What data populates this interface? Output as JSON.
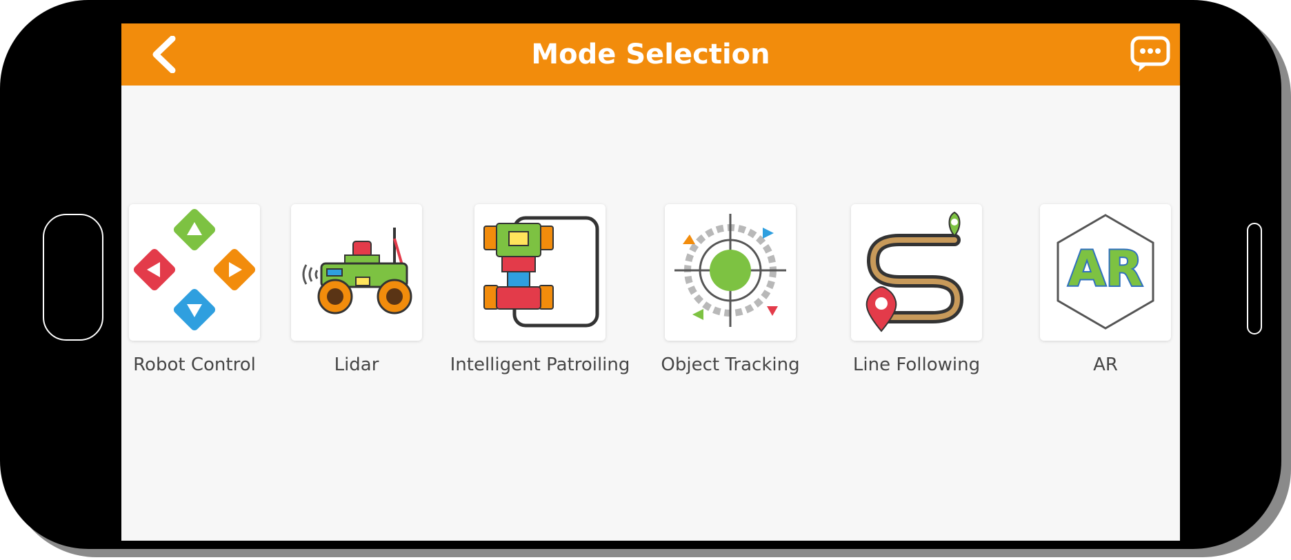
{
  "appbar": {
    "title": "Mode Selection",
    "back_icon": "chevron-left-icon",
    "message_icon": "chat-bubble-icon",
    "accent_color": "#f28c0c"
  },
  "modes": [
    {
      "label": "Robot Control",
      "icon": "direction-pad-icon"
    },
    {
      "label": "Lidar",
      "icon": "lidar-robot-car-icon"
    },
    {
      "label": "Intelligent Patroiling",
      "icon": "patrol-track-robot-icon"
    },
    {
      "label": "Object Tracking",
      "icon": "target-crosshair-icon"
    },
    {
      "label": "Line Following",
      "icon": "route-line-icon"
    },
    {
      "label": "AR",
      "icon": "ar-hexagon-icon"
    }
  ],
  "ar_icon_text": "AR"
}
